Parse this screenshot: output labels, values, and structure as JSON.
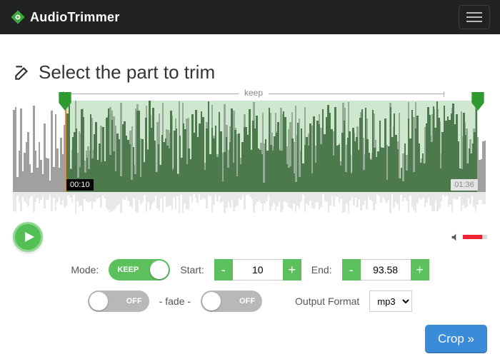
{
  "brand": {
    "name_bold": "Audio",
    "name_rest": "Trimmer"
  },
  "heading": "Select the part to trim",
  "keep_label": "keep",
  "selection": {
    "start_pct": 11,
    "end_pct": 98,
    "start_label": "00:10",
    "end_label": "01:36"
  },
  "volume": {
    "level_pct": 78
  },
  "controls": {
    "mode_label": "Mode:",
    "mode_value": "KEEP",
    "start_label": "Start:",
    "start_value": "10",
    "end_label": "End:",
    "end_value": "93.58",
    "fade_sep": "- fade -",
    "fade_in_value": "OFF",
    "fade_out_value": "OFF",
    "format_label": "Output Format",
    "format_value": "mp3"
  },
  "crop_button": "Crop »"
}
